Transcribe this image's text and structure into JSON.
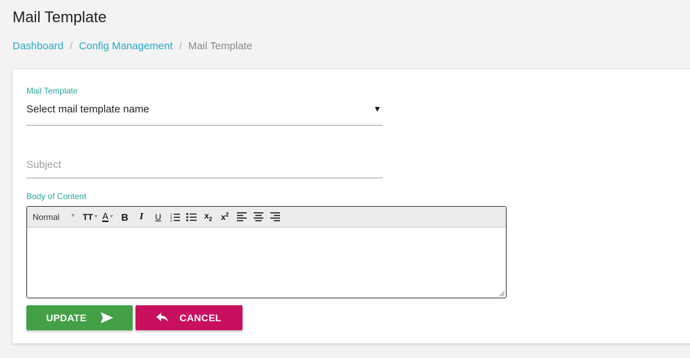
{
  "page": {
    "title": "Mail Template"
  },
  "breadcrumb": {
    "items": [
      {
        "label": "Dashboard"
      },
      {
        "label": "Config Management"
      },
      {
        "label": "Mail Template"
      }
    ],
    "separator": "/"
  },
  "form": {
    "mail_template": {
      "label": "Mail Template",
      "selected": "Select mail template name",
      "caret": "▾"
    },
    "subject": {
      "placeholder": "Subject",
      "value": ""
    },
    "body": {
      "label": "Body of Content",
      "value": "",
      "toolbar": {
        "format": "Normal",
        "text_size": "TT",
        "font_color": "A",
        "bold": "B",
        "italic": "I",
        "underline": "U",
        "subscript": "x",
        "subscript_sub": "2",
        "superscript": "x",
        "superscript_sup": "2"
      }
    }
  },
  "actions": {
    "update_label": "UPDATE",
    "cancel_label": "CANCEL"
  },
  "colors": {
    "accent_teal": "#26a69a",
    "link": "#29a9c8",
    "update_green": "#43a047",
    "cancel_magenta": "#c8105f"
  }
}
